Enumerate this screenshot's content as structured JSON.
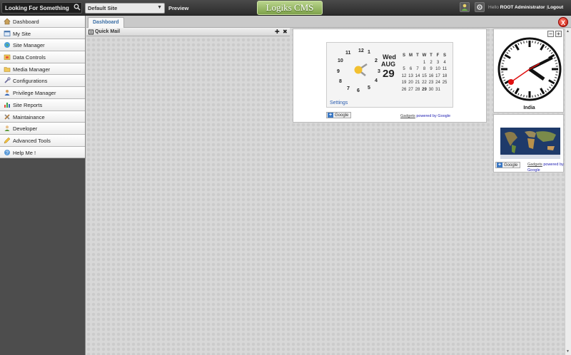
{
  "topbar": {
    "search_placeholder": "Looking For Something",
    "site_select_value": "Default Site",
    "preview_label": "Preview",
    "logo_text": "Logiks CMS",
    "hello_label": "Hello",
    "user_name": "ROOT Administrator",
    "separator": "|",
    "logout_label": "Logout"
  },
  "sidebar": {
    "items": [
      {
        "label": "Dashboard",
        "icon": "home-icon"
      },
      {
        "label": "My Site",
        "icon": "window-icon"
      },
      {
        "label": "Site Manager",
        "icon": "globe-icon"
      },
      {
        "label": "Data Controls",
        "icon": "folder-icon"
      },
      {
        "label": "Media Manager",
        "icon": "media-folder-icon"
      },
      {
        "label": "Configurations",
        "icon": "wrench-icon"
      },
      {
        "label": "Privilege Manager",
        "icon": "users-icon"
      },
      {
        "label": "Site Reports",
        "icon": "chart-icon"
      },
      {
        "label": "Maintainance",
        "icon": "tools-icon"
      },
      {
        "label": "Developer",
        "icon": "developer-icon"
      },
      {
        "label": "Advanced Tools",
        "icon": "pencil-icon"
      },
      {
        "label": "Help Me !",
        "icon": "help-icon"
      }
    ]
  },
  "tabs": {
    "active_label": "Dashboard",
    "close_label": "X"
  },
  "quickmail": {
    "title": "Quick Mail",
    "pin_label": "✚",
    "close_label": "✖"
  },
  "calendar_gadget": {
    "day": "Wed",
    "month": "AUG",
    "date": "29",
    "clock_numbers": [
      "12",
      "1",
      "2",
      "3",
      "4",
      "5",
      "6",
      "7",
      "8",
      "9",
      "10",
      "11"
    ],
    "week_headers": [
      "S",
      "M",
      "T",
      "W",
      "T",
      "F",
      "S"
    ],
    "weeks": [
      [
        "",
        "",
        "",
        "",
        "1",
        "2",
        "3",
        "4"
      ],
      [
        "5",
        "6",
        "7",
        "8",
        "9",
        "10",
        "11"
      ],
      [
        "12",
        "13",
        "14",
        "15",
        "16",
        "17",
        "18"
      ],
      [
        "19",
        "20",
        "21",
        "22",
        "23",
        "24",
        "25"
      ],
      [
        "26",
        "27",
        "28",
        "29",
        "30",
        "31",
        ""
      ]
    ],
    "settings_label": "Settings",
    "google_label": "Google",
    "gadgets_label": "Gadgets",
    "powered_label": "powered by Google"
  },
  "world_clock": {
    "minus_label": "−",
    "plus_label": "+",
    "location": "India"
  },
  "world_map": {
    "google_label": "Google",
    "gadgets_label": "Gadgets",
    "powered_label": "powered by Google"
  },
  "colors": {
    "logo_green": "#8fb25a",
    "tab_text": "#3a6ea5",
    "close_red": "#c21a0a"
  }
}
